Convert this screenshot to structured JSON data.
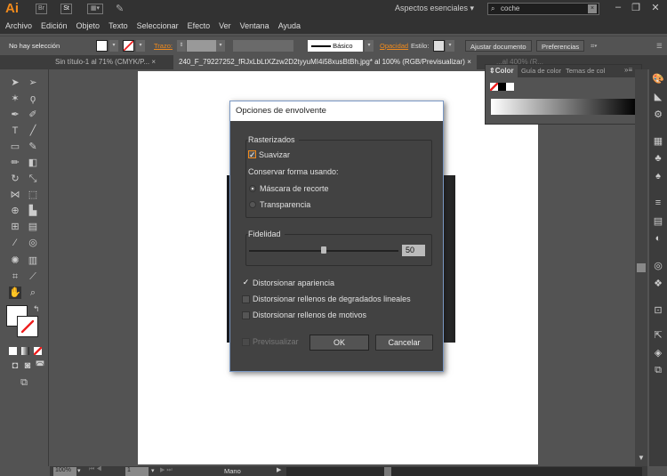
{
  "app": {
    "logo": "Ai",
    "bridge": "Br",
    "stock": "St",
    "workspace": "Aspectos esenciales",
    "search_value": "coche"
  },
  "menu": [
    "Archivo",
    "Edición",
    "Objeto",
    "Texto",
    "Seleccionar",
    "Efecto",
    "Ver",
    "Ventana",
    "Ayuda"
  ],
  "control": {
    "selection": "No hay selección",
    "stroke_label": "Trazo:",
    "brush": "Básico",
    "opacity_label": "Opacidad",
    "style_label": "Estilo:",
    "adjust_button": "Ajustar documento",
    "prefs_button": "Preferencias"
  },
  "tabs": [
    {
      "label": "Sin título-1 al 71% (CMYK/P...",
      "close": "×"
    },
    {
      "label": "240_F_79227252_fRJxLbLtXZzw2D2tyyuMI4i58xusBtBh.jpg* al 100% (RGB/Previsualizar)",
      "close": "×"
    },
    {
      "label": "...al 400% (R..."
    }
  ],
  "color_panel": {
    "tabs": [
      "Color",
      "Guía de color",
      "Temas de col"
    ]
  },
  "dialog": {
    "title": "Opciones de envolvente",
    "raster_group": "Rasterizados",
    "smooth": {
      "label": "Suavizar",
      "checked": true
    },
    "preserve_label": "Conservar forma usando:",
    "radios": [
      {
        "label": "Máscara de recorte",
        "selected": true
      },
      {
        "label": "Transparencia",
        "selected": false
      }
    ],
    "fidelity_group": "Fidelidad",
    "fidelity_value": "50",
    "fidelity_percent": 50,
    "checks": [
      {
        "label": "Distorsionar apariencia",
        "checked": true
      },
      {
        "label": "Distorsionar rellenos de degradados lineales",
        "checked": false
      },
      {
        "label": "Distorsionar rellenos de motivos",
        "checked": false
      }
    ],
    "preview": {
      "label": "Previsualizar",
      "checked": false
    },
    "ok": "OK",
    "cancel": "Cancelar"
  },
  "status": {
    "zoom": "100%",
    "page": "1",
    "tool": "Mano"
  },
  "colors": {
    "accent": "#f08a1c",
    "dialog_border": "#7a98c4"
  }
}
